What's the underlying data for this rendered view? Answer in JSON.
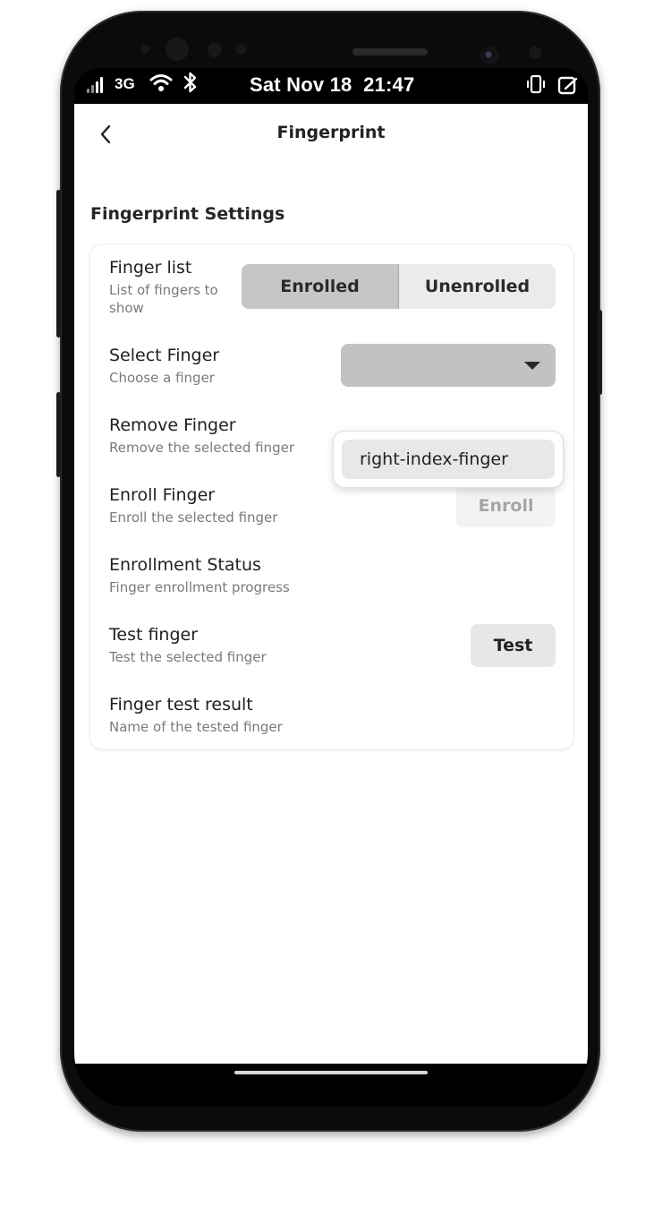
{
  "status_bar": {
    "network": "3G",
    "clock": "Sat Nov 18  21:47",
    "icons": [
      "signal-icon",
      "wifi-icon",
      "bluetooth-icon",
      "vibrate-icon",
      "battery-icon"
    ]
  },
  "header": {
    "back_icon": "chevron-left-icon",
    "title": "Fingerprint"
  },
  "section_title": "Fingerprint Settings",
  "rows": {
    "finger_list": {
      "title": "Finger list",
      "subtitle": "List of fingers to show",
      "options": [
        "Enrolled",
        "Unenrolled"
      ],
      "selected": "Enrolled"
    },
    "select_finger": {
      "title": "Select Finger",
      "subtitle": "Choose a finger",
      "value": "",
      "menu_option": "right-index-finger"
    },
    "remove_finger": {
      "title": "Remove Finger",
      "subtitle": "Remove the selected finger"
    },
    "enroll_finger": {
      "title": "Enroll Finger",
      "subtitle": "Enroll the selected finger",
      "button": "Enroll"
    },
    "enrollment_status": {
      "title": "Enrollment Status",
      "subtitle": "Finger enrollment progress"
    },
    "test_finger": {
      "title": "Test finger",
      "subtitle": "Test the selected finger",
      "button": "Test"
    },
    "finger_test_result": {
      "title": "Finger test result",
      "subtitle": "Name of the tested finger"
    }
  },
  "colors": {
    "segment_active": "#c6c6c6",
    "segment_inactive": "#ebebeb",
    "dropdown": "#c2c2c2",
    "button_disabled_text": "#a6a6a6"
  }
}
